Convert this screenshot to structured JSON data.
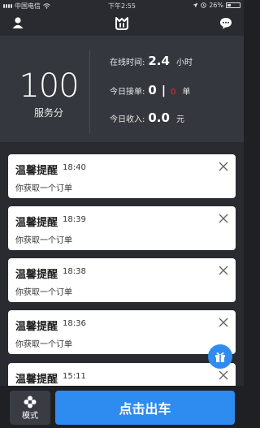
{
  "status_bar": {
    "carrier": "中国电信",
    "time": "下午2:55",
    "battery_percent": "26%",
    "battery_level": 0.26
  },
  "header": {
    "left_icon": "user-icon",
    "logo_icon": "app-logo-icon",
    "right_icon": "message-icon"
  },
  "stats": {
    "score": "100",
    "score_label": "服务分",
    "online_label": "在线时间:",
    "online_value": "2.4",
    "online_unit": "小时",
    "orders_label": "今日接单:",
    "orders_value": "0",
    "orders_separator": "|",
    "orders_extra": "0",
    "orders_unit": "单",
    "income_label": "今日收入:",
    "income_value": "0.0",
    "income_unit": "元"
  },
  "notifications": [
    {
      "title": "温馨提醒",
      "time": "18:40",
      "message": "你获取一个订单"
    },
    {
      "title": "温馨提醒",
      "time": "18:39",
      "message": "你获取一个订单"
    },
    {
      "title": "温馨提醒",
      "time": "18:38",
      "message": "你获取一个订单"
    },
    {
      "title": "温馨提醒",
      "time": "18:36",
      "message": "你获取一个订单"
    },
    {
      "title": "温馨提醒",
      "time": "15:11",
      "message": ""
    }
  ],
  "bottom": {
    "mode_label": "模式",
    "depart_label": "点击出车"
  },
  "colors": {
    "accent": "#2e8bf0",
    "alert": "#e03030",
    "panel": "#35373e",
    "background": "#2a2b30"
  }
}
